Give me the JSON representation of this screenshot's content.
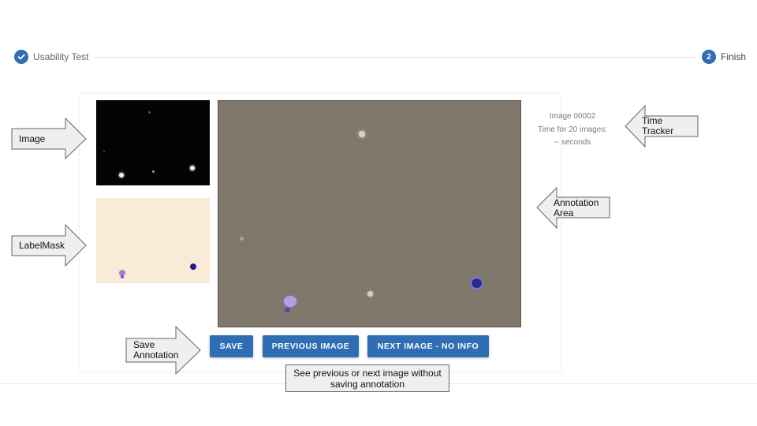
{
  "stepper": {
    "step1": {
      "icon": "check-icon",
      "label": "Usability Test"
    },
    "step2": {
      "number": "2",
      "label": "Finish"
    }
  },
  "info": {
    "image_id": "Image 00002",
    "time_label": "Time for 20 images:",
    "time_value": "-- seconds"
  },
  "buttons": {
    "save": "SAVE",
    "previous": "PREVIOUS IMAGE",
    "next": "NEXT IMAGE - NO INFO"
  },
  "callouts": {
    "image": "Image",
    "labelmask": "LabelMask",
    "save_annotation": "Save Annotation",
    "time_tracker": "Time Tracker",
    "annotation_area": "Annotation Area",
    "nav_note": "See previous or next image without saving annotation"
  },
  "colors": {
    "accent": "#2f6db5",
    "annotation_bg": "#7f766c",
    "mask_bg": "#faebd8",
    "image_bg": "#030303"
  }
}
